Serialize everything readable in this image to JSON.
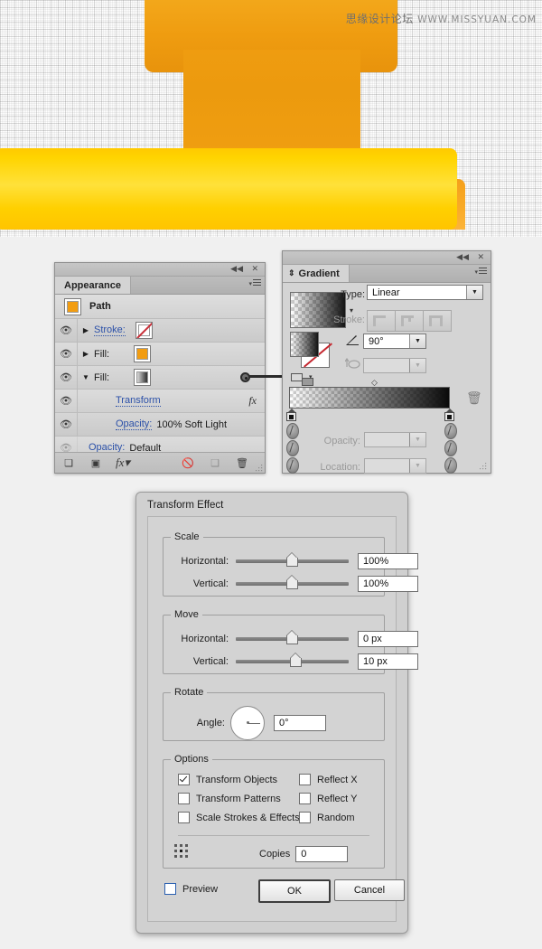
{
  "artboard": {
    "watermark_cn": "思缘设计论坛",
    "watermark_url": "WWW.MISSYUAN.COM"
  },
  "appearance_panel": {
    "tab_label": "Appearance",
    "target_label": "Path",
    "rows": [
      {
        "label": "Stroke:",
        "value": "",
        "swatch": "none",
        "arrow": "collapsed",
        "visible": true
      },
      {
        "label": "Fill:",
        "value": "",
        "swatch": "orange",
        "arrow": "collapsed",
        "visible": true
      },
      {
        "label": "Fill:",
        "value": "",
        "swatch": "gradient",
        "arrow": "expanded",
        "visible": true
      },
      {
        "label": "Transform",
        "value": "",
        "swatch": "",
        "arrow": "",
        "visible": true,
        "fx": "fx"
      },
      {
        "label": "Opacity:",
        "value": "100% Soft Light",
        "swatch": "",
        "arrow": "",
        "visible": true
      },
      {
        "label": "Opacity:",
        "value": "Default",
        "swatch": "",
        "arrow": "",
        "visible": false
      }
    ],
    "bottom_buttons": [
      "add-new-stroke-icon",
      "add-new-fill-icon",
      "add-new-effect-icon",
      "clear-appearance-icon",
      "duplicate-item-icon",
      "delete-item-icon"
    ]
  },
  "gradient_panel": {
    "tab_label": "Gradient",
    "type_label": "Type:",
    "type_value": "Linear",
    "stroke_label": "Stroke:",
    "angle_value": "90°",
    "aspect_value": "",
    "opacity_label": "Opacity:",
    "opacity_value": "",
    "location_label": "Location:",
    "location_value": "",
    "gradient_stops": [
      {
        "position": 0,
        "color": "#ffffff",
        "opacity": 0
      },
      {
        "position": 100,
        "color": "#000000",
        "opacity": 100
      }
    ],
    "midpoint": 50
  },
  "dialog": {
    "title": "Transform Effect",
    "groups": {
      "scale": {
        "legend": "Scale",
        "fields": [
          {
            "label": "Horizontal:",
            "value": "100%",
            "slider": 50
          },
          {
            "label": "Vertical:",
            "value": "100%",
            "slider": 50
          }
        ]
      },
      "move": {
        "legend": "Move",
        "fields": [
          {
            "label": "Horizontal:",
            "value": "0 px",
            "slider": 50
          },
          {
            "label": "Vertical:",
            "value": "10 px",
            "slider": 53
          }
        ]
      },
      "rotate": {
        "legend": "Rotate",
        "angle_label": "Angle:",
        "angle_value": "0°"
      },
      "options": {
        "legend": "Options",
        "checkboxes": [
          {
            "label": "Transform Objects",
            "checked": true
          },
          {
            "label": "Transform Patterns",
            "checked": false
          },
          {
            "label": "Scale Strokes & Effects",
            "checked": false
          },
          {
            "label": "Reflect X",
            "checked": false
          },
          {
            "label": "Reflect Y",
            "checked": false
          },
          {
            "label": "Random",
            "checked": false
          }
        ],
        "copies_label": "Copies",
        "copies_value": "0"
      }
    },
    "preview_label": "Preview",
    "preview_checked": false,
    "ok_label": "OK",
    "cancel_label": "Cancel"
  },
  "colors": {
    "artwork_orange_light": "#f3a81b",
    "artwork_orange_dark": "#e8930c",
    "artwork_yellow": "#ffd400",
    "panel_bg": "#d4d4d4",
    "link_blue": "#2b50a8",
    "accent_blue": "#2a5fb0"
  }
}
